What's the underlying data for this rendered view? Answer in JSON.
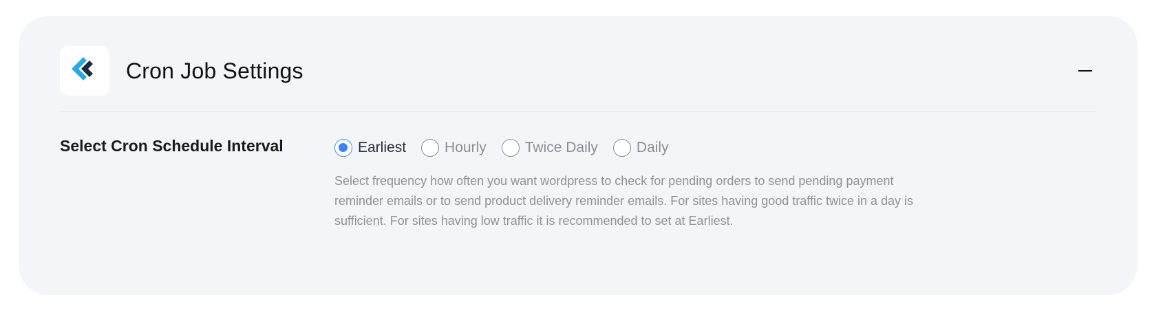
{
  "header": {
    "title": "Cron Job Settings",
    "logo_icon": "brand-logo-icon",
    "collapse_icon": "minus-icon"
  },
  "field": {
    "label": "Select Cron Schedule Interval",
    "options": [
      {
        "label": "Earliest",
        "selected": true
      },
      {
        "label": "Hourly",
        "selected": false
      },
      {
        "label": "Twice Daily",
        "selected": false
      },
      {
        "label": "Daily",
        "selected": false
      }
    ],
    "help_text": "Select frequency how often you want wordpress to check for pending orders to send pending payment reminder emails or to send product delivery reminder emails. For sites having good traffic twice in a day is sufficient. For sites having low traffic it is recommended to set at Earliest."
  },
  "colors": {
    "card_bg": "#f4f5f9",
    "accent": "#3b82f6",
    "logo_blue": "#29a9e0",
    "logo_dark": "#1c2a3a"
  }
}
